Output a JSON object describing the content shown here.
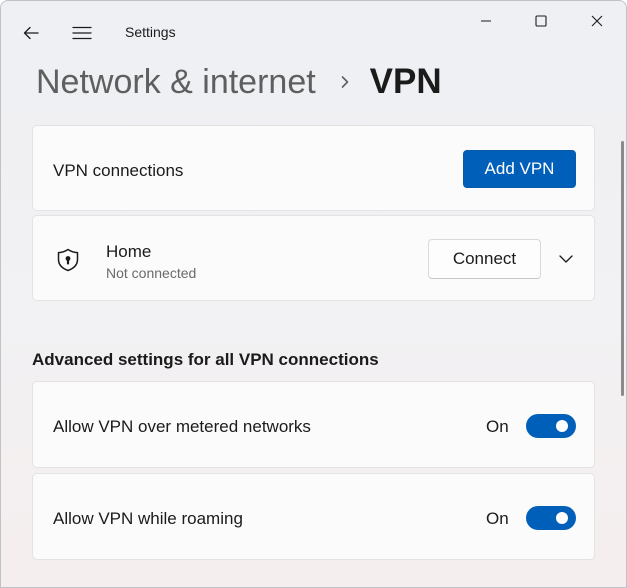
{
  "window": {
    "app_title": "Settings",
    "controls": [
      "minimize-icon",
      "maximize-icon",
      "close-icon"
    ]
  },
  "breadcrumb": {
    "parent": "Network & internet",
    "separator_icon": "chevron-right-icon",
    "current": "VPN"
  },
  "vpn_connections": {
    "label": "VPN connections",
    "add_button": "Add VPN"
  },
  "connection": {
    "icon": "shield-icon",
    "name": "Home",
    "status": "Not connected",
    "connect_button": "Connect",
    "expand_icon": "chevron-down-icon"
  },
  "advanced": {
    "heading": "Advanced settings for all VPN connections",
    "settings": [
      {
        "label": "Allow VPN over metered networks",
        "state": "On",
        "enabled": true
      },
      {
        "label": "Allow VPN while roaming",
        "state": "On",
        "enabled": true
      }
    ]
  },
  "colors": {
    "accent": "#005fb8",
    "background": "#f0f0f2",
    "card": "#fbfbfb"
  }
}
